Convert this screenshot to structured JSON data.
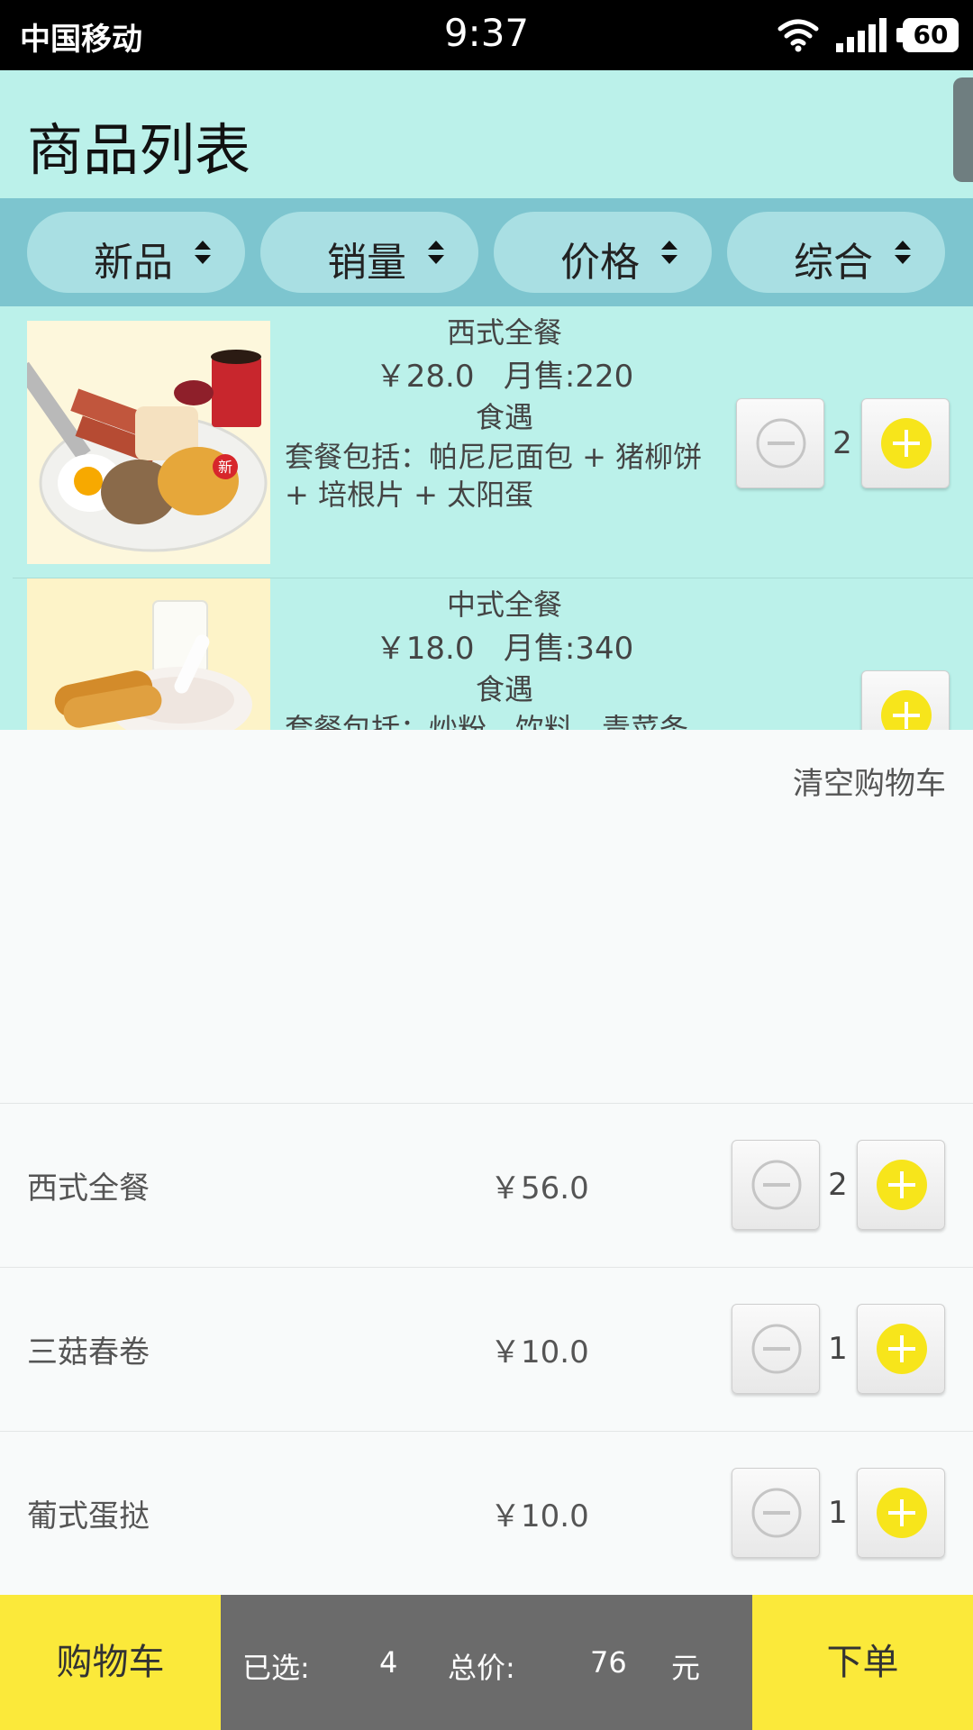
{
  "status_bar": {
    "carrier": "中国移动",
    "time": "9:37",
    "battery": "60",
    "icons": [
      "wifi-icon",
      "signal-icon",
      "battery-icon"
    ]
  },
  "header": {
    "title": "商品列表"
  },
  "sort_bar": {
    "items": [
      {
        "label": "新品",
        "icon": "sort-arrows-icon"
      },
      {
        "label": "销量",
        "icon": "sort-arrows-icon"
      },
      {
        "label": "价格",
        "icon": "sort-arrows-icon"
      },
      {
        "label": "综合",
        "icon": "sort-arrows-icon"
      }
    ]
  },
  "products": [
    {
      "name": "西式全餐",
      "price": "￥28.0",
      "monthly_sales": "月售:220",
      "shop": "食遇",
      "description": "套餐包括：帕尼尼面包 + 猪柳饼 + 培根片 + 太阳蛋",
      "image": "western-breakfast-image",
      "quantity": "2"
    },
    {
      "name": "中式全餐",
      "price": "￥18.0",
      "monthly_sales": "月售:340",
      "shop": "食遇",
      "description": "套餐包括：炒粉，饮料，青菜条",
      "image": "chinese-breakfast-image",
      "quantity": ""
    }
  ],
  "cart": {
    "clear_label": "清空购物车",
    "items": [
      {
        "name": "西式全餐",
        "price": "￥56.0",
        "quantity": "2"
      },
      {
        "name": "三菇春卷",
        "price": "￥10.0",
        "quantity": "1"
      },
      {
        "name": "葡式蛋挞",
        "price": "￥10.0",
        "quantity": "1"
      }
    ]
  },
  "bottom_bar": {
    "cart_label": "购物车",
    "selected_label": "已选:",
    "selected_count": "4",
    "total_label": "总价:",
    "total_value": "76",
    "currency": "元",
    "order_label": "下单"
  },
  "colors": {
    "status_bar": "#000000",
    "title_bar": "#bbf1ea",
    "sort_bar": "#7dc5cf",
    "sort_pill": "#a9dfe3",
    "accent_yellow": "#fbe93a",
    "plus_circle": "#f7e51b",
    "summary_bg": "#6b6b6b"
  }
}
